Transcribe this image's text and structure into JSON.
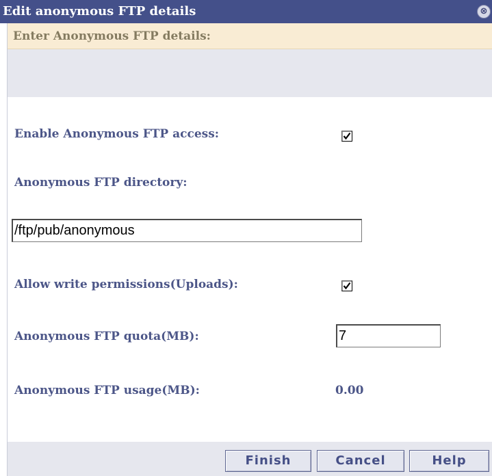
{
  "dialog": {
    "title": "Edit anonymous FTP details",
    "close_icon_glyph": "⊗",
    "header": "Enter Anonymous FTP details:"
  },
  "form": {
    "enable_access": {
      "label": "Enable Anonymous FTP access:",
      "checked": true
    },
    "directory": {
      "label": "Anonymous FTP directory:",
      "value": "/ftp/pub/anonymous"
    },
    "allow_write": {
      "label": "Allow write permissions(Uploads):",
      "checked": true
    },
    "quota": {
      "label": "Anonymous FTP quota(MB):",
      "value": "7"
    },
    "usage": {
      "label": "Anonymous FTP usage(MB):",
      "value": "0.00"
    }
  },
  "buttons": {
    "finish": "Finish",
    "cancel": "Cancel",
    "help": "Help"
  },
  "colors": {
    "titlebar": "#44508a",
    "header_band": "#f9ecd4",
    "label_text": "#4c5688",
    "grey_band": "#e6e7ee"
  }
}
